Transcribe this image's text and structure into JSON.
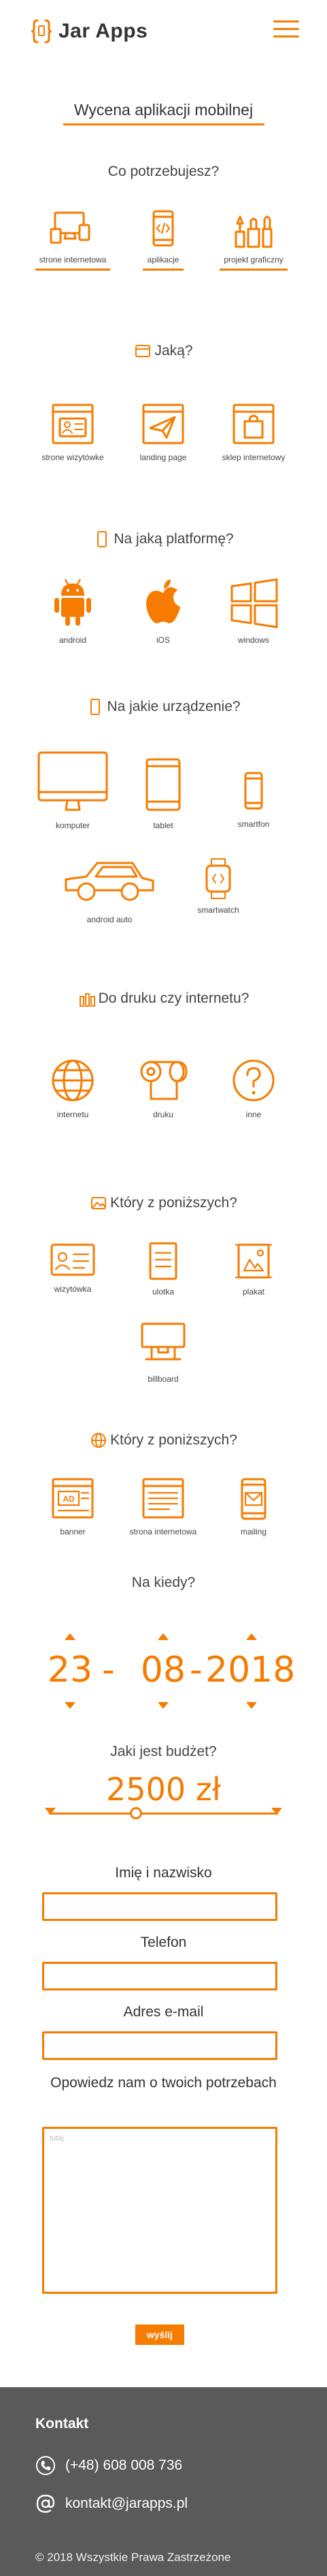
{
  "header": {
    "brand": "Jar Apps",
    "logo_icon": "curly-braces-phone-logo",
    "menu_icon": "hamburger-menu-icon",
    "accent": "#f57c00"
  },
  "page_title": "Wycena aplikacji mobilnej",
  "needs": {
    "title": "Co potrzebujesz?",
    "options": [
      {
        "label": "strone internetowa",
        "icon": "desktop-devices-icon",
        "selected": true
      },
      {
        "label": "aplikacje",
        "icon": "code-phone-icon",
        "selected": true
      },
      {
        "label": "projekt graficzny",
        "icon": "graphic-tools-icon",
        "selected": true
      }
    ]
  },
  "how": {
    "title": "Jaką?",
    "options": [
      {
        "label": "strone wizytówke",
        "icon": "business-card-page-icon"
      },
      {
        "label": "landing page",
        "icon": "paper-plane-page-icon"
      },
      {
        "label": "sklep internetowy",
        "icon": "shopping-bag-page-icon"
      }
    ]
  },
  "platform": {
    "title": "Na jaką platformę?",
    "options": [
      {
        "label": "android",
        "icon": "android-icon"
      },
      {
        "label": "iOS",
        "icon": "apple-icon"
      },
      {
        "label": "windows",
        "icon": "windows-icon"
      }
    ]
  },
  "devices": {
    "title": "Na jakie urządzenie?",
    "options": [
      {
        "label": "komputer",
        "icon": "monitor-icon"
      },
      {
        "label": "tablet",
        "icon": "tablet-icon"
      },
      {
        "label": "smartfon",
        "icon": "smartphone-icon"
      },
      {
        "label": "android auto",
        "icon": "car-icon"
      },
      {
        "label": "smartwatch",
        "icon": "smartwatch-icon"
      }
    ]
  },
  "print": {
    "title": "Do druku czy internetu?",
    "options": [
      {
        "label": "internetu",
        "icon": "globe-icon"
      },
      {
        "label": "druku",
        "icon": "paper-roll-icon"
      },
      {
        "label": "inne",
        "icon": "question-icon"
      }
    ]
  },
  "print_type": {
    "title": "Który z poniższych?",
    "options": [
      {
        "label": "wizytówka",
        "icon": "business-card-icon"
      },
      {
        "label": "ulotka",
        "icon": "leaflet-icon"
      },
      {
        "label": "plakat",
        "icon": "poster-icon"
      },
      {
        "label": "billboard",
        "icon": "billboard-icon"
      }
    ]
  },
  "web_type": {
    "title": "Który z poniższych?",
    "options": [
      {
        "label": "banner",
        "icon": "banner-ad-icon"
      },
      {
        "label": "strona internetowa",
        "icon": "webpage-icon"
      },
      {
        "label": "mailing",
        "icon": "mail-phone-icon"
      }
    ]
  },
  "when": {
    "title": "Na kiedy?",
    "day": "23",
    "month": "08",
    "year": "2018",
    "separator": "-"
  },
  "budget": {
    "title": "Jaki jest budżet?",
    "value": "2500 zł",
    "slider_fraction": 0.38
  },
  "form": {
    "name_label": "Imię i nazwisko",
    "phone_label": "Telefon",
    "email_label": "Adres e-mail",
    "message_label": "Opowiedz nam o twoich potrzebach",
    "message_placeholder": "tutaj",
    "submit": "wyślij"
  },
  "footer": {
    "title": "Kontakt",
    "phone": "(+48) 608 008 736",
    "email": "kontakt@jarapps.pl",
    "copyright": "© 2018 Wszystkie Prawa Zastrzeżone",
    "background": "#5a5a5a"
  }
}
